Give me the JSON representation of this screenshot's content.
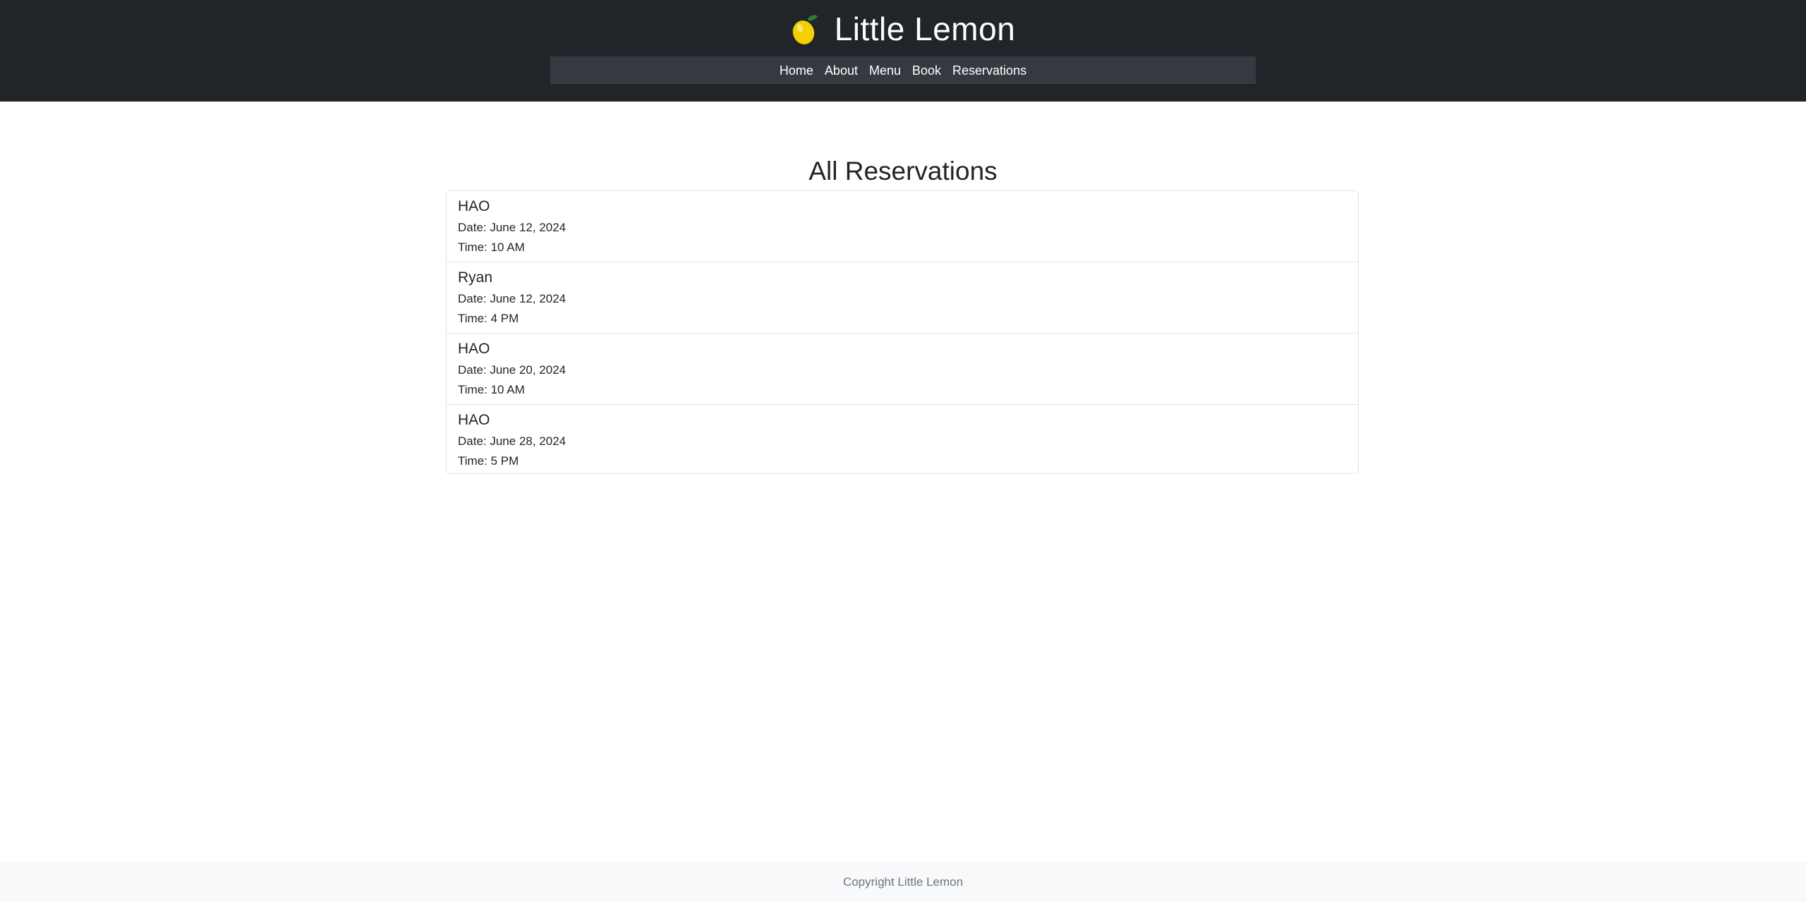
{
  "header": {
    "title": "Little Lemon",
    "logo_icon": "lemon-icon",
    "background": "#212529",
    "nav": [
      {
        "label": "Home"
      },
      {
        "label": "About"
      },
      {
        "label": "Menu"
      },
      {
        "label": "Book"
      },
      {
        "label": "Reservations"
      }
    ]
  },
  "main": {
    "title": "All Reservations",
    "reservations": [
      {
        "name": "HAO",
        "date": "Date: June 12, 2024",
        "time": "Time: 10 AM"
      },
      {
        "name": "Ryan",
        "date": "Date: June 12, 2024",
        "time": "Time: 4 PM"
      },
      {
        "name": "HAO",
        "date": "Date: June 20, 2024",
        "time": "Time: 10 AM"
      },
      {
        "name": "HAO",
        "date": "Date: June 28, 2024",
        "time": "Time: 5 PM"
      }
    ]
  },
  "footer": {
    "text": "Copyright Little Lemon"
  }
}
